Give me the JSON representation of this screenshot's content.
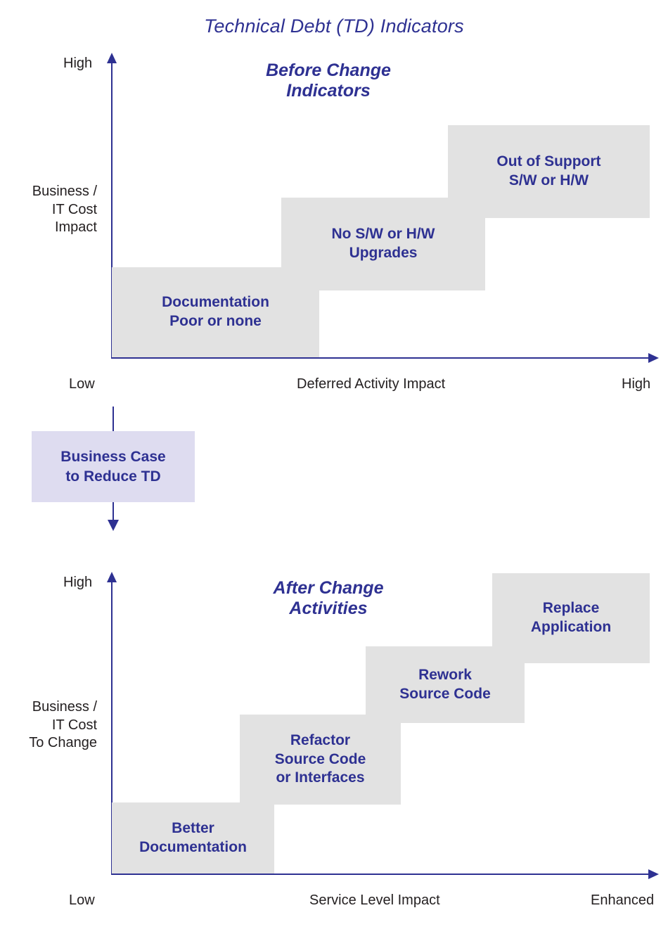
{
  "title": "Technical Debt (TD) Indicators",
  "charts": [
    {
      "heading": "Before Change\nIndicators",
      "y_axis": {
        "label": "Business /\nIT Cost\nImpact",
        "top_tick": "High"
      },
      "x_axis": {
        "label": "Deferred Activity Impact",
        "left_tick": "Low",
        "right_tick": "High"
      },
      "steps": [
        {
          "label": "Documentation\nPoor or none"
        },
        {
          "label": "No S/W or H/W\nUpgrades"
        },
        {
          "label": "Out of Support\nS/W or H/W"
        }
      ]
    },
    {
      "heading": "After Change\nActivities",
      "y_axis": {
        "label": "Business /\nIT Cost\nTo Change",
        "top_tick": "High"
      },
      "x_axis": {
        "label": "Service Level Impact",
        "left_tick": "Low",
        "right_tick": "Enhanced"
      },
      "steps": [
        {
          "label": "Better\nDocumentation"
        },
        {
          "label": "Refactor\nSource Code\nor Interfaces"
        },
        {
          "label": "Rework\nSource Code"
        },
        {
          "label": "Replace\nApplication"
        }
      ]
    }
  ],
  "callout": {
    "label": "Business Case\nto Reduce TD"
  },
  "chart_data": {
    "type": "bar",
    "title": "Technical Debt (TD) Indicators",
    "panels": [
      {
        "name": "Before Change Indicators",
        "xlabel": "Deferred Activity Impact",
        "ylabel": "Business / IT Cost Impact",
        "xlim_labels": [
          "Low",
          "High"
        ],
        "ylim_labels": [
          "",
          "High"
        ],
        "grid": false,
        "legend": "none",
        "categories": [
          "Documentation Poor or none",
          "No S/W or H/W Upgrades",
          "Out of Support S/W or H/W"
        ],
        "values": [
          1,
          2,
          3
        ],
        "boxes": [
          {
            "label": "Documentation Poor or none",
            "x0": 0.0,
            "x1": 0.37,
            "y0": 0.0,
            "y1": 0.28
          },
          {
            "label": "No S/W or H/W Upgrades",
            "x0": 0.31,
            "x1": 0.68,
            "y0": 0.21,
            "y1": 0.51
          },
          {
            "label": "Out of Support S/W or H/W",
            "x0": 0.62,
            "x1": 1.0,
            "y0": 0.44,
            "y1": 0.74
          }
        ]
      },
      {
        "name": "After Change Activities",
        "xlabel": "Service Level Impact",
        "ylabel": "Business / IT Cost To Change",
        "xlim_labels": [
          "Low",
          "Enhanced"
        ],
        "ylim_labels": [
          "",
          "High"
        ],
        "grid": false,
        "legend": "none",
        "categories": [
          "Better Documentation",
          "Refactor Source Code or Interfaces",
          "Rework Source Code",
          "Replace Application"
        ],
        "values": [
          1,
          2,
          3,
          4
        ],
        "boxes": [
          {
            "label": "Better Documentation",
            "x0": 0.0,
            "x1": 0.3,
            "y0": 0.0,
            "y1": 0.22
          },
          {
            "label": "Refactor Source Code or Interfaces",
            "x0": 0.24,
            "x1": 0.53,
            "y0": 0.18,
            "y1": 0.47
          },
          {
            "label": "Rework Source Code",
            "x0": 0.44,
            "x1": 0.76,
            "y0": 0.43,
            "y1": 0.67
          },
          {
            "label": "Replace Application",
            "x0": 0.7,
            "x1": 1.0,
            "y0": 0.62,
            "y1": 0.88
          }
        ]
      }
    ],
    "flow_annotation": "Business Case to Reduce TD"
  },
  "colors": {
    "accent": "#2e3192",
    "box_fill": "#e2e2e2",
    "callout_fill": "#dedcf0",
    "axis_text": "#231f20",
    "background": "#ffffff"
  }
}
